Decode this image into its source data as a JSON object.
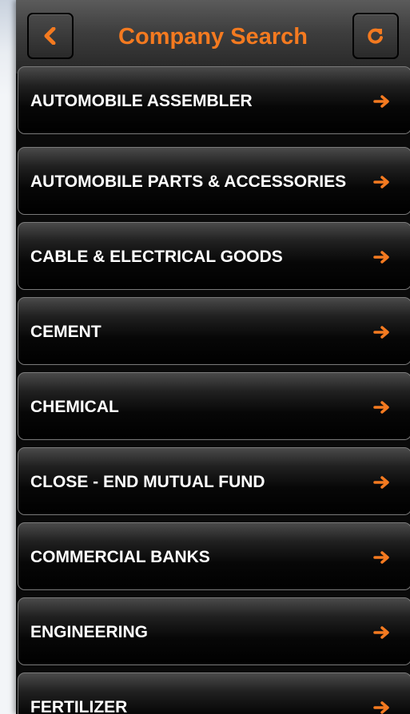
{
  "header": {
    "title": "Company Search",
    "back_icon": "chevron-left-icon",
    "refresh_icon": "refresh-icon"
  },
  "colors": {
    "accent": "#f47a20",
    "row_text": "#ffffff",
    "background": "#000000"
  },
  "sectors": [
    {
      "label": "AUTOMOBILE ASSEMBLER"
    },
    {
      "label": "AUTOMOBILE PARTS & ACCESSORIES"
    },
    {
      "label": "CABLE & ELECTRICAL GOODS"
    },
    {
      "label": "CEMENT"
    },
    {
      "label": "CHEMICAL"
    },
    {
      "label": "CLOSE - END MUTUAL FUND"
    },
    {
      "label": "COMMERCIAL BANKS"
    },
    {
      "label": "ENGINEERING"
    },
    {
      "label": "FERTILIZER"
    }
  ]
}
